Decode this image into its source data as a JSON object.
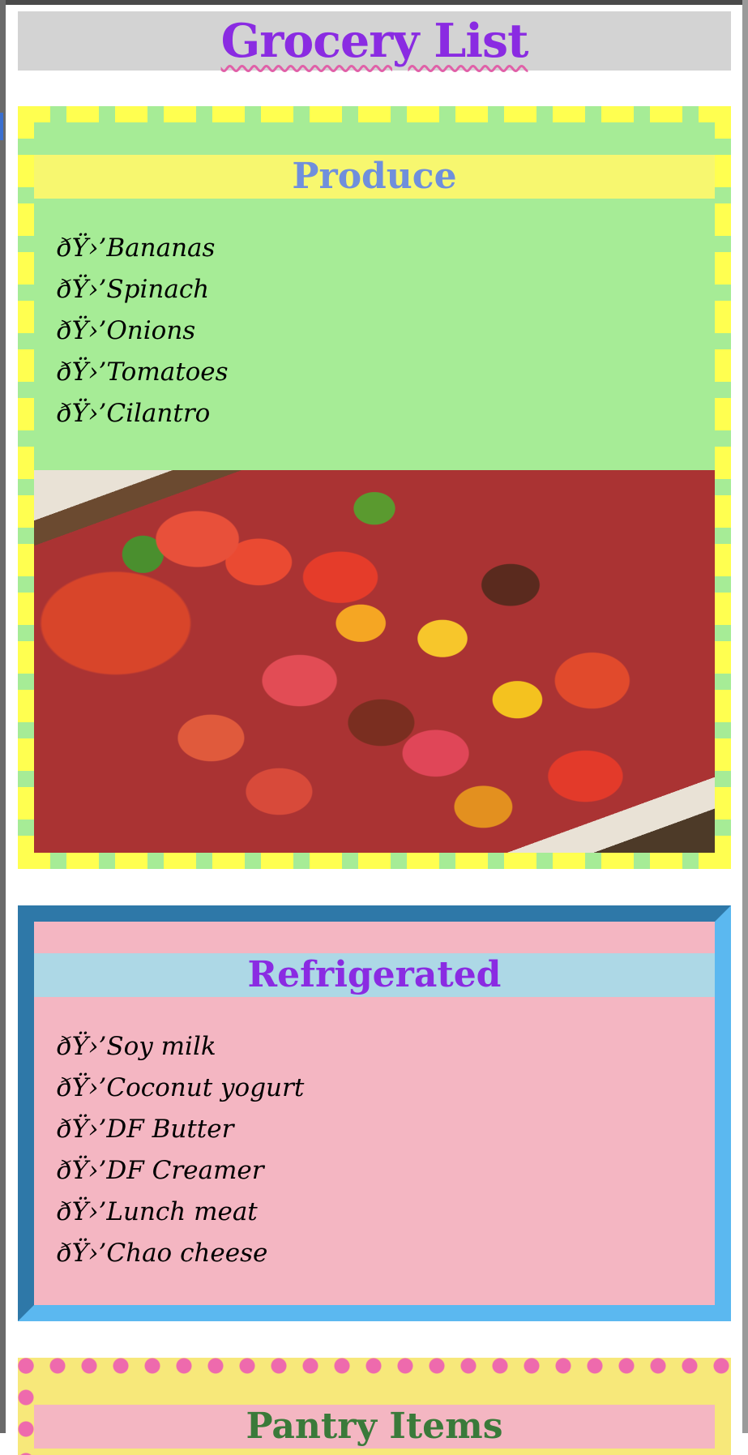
{
  "page": {
    "title": "Grocery List"
  },
  "colors": {
    "title": "#8a2be2",
    "produce_bg": "#a6ec96",
    "produce_heading_bg": "#f7f76f",
    "produce_heading_text": "#6f8fdc",
    "fridge_bg": "#f4b6c2",
    "fridge_heading_bg": "#add8e6",
    "fridge_border": "#2e78a8",
    "pantry_bg": "#f7e87a",
    "pantry_dots": "#ee6aad",
    "pantry_heading_text": "#3a7a3a"
  },
  "sections": {
    "produce": {
      "heading": "Produce",
      "items": [
        "ðŸ›’Bananas",
        "ðŸ›’Spinach",
        "ðŸ›’Onions",
        "ðŸ›’Tomatoes",
        "ðŸ›’Cilantro"
      ],
      "image_icon": "tomatoes-photo"
    },
    "refrigerated": {
      "heading": "Refrigerated",
      "items": [
        "ðŸ›’Soy milk",
        "ðŸ›’Coconut yogurt",
        "ðŸ›’DF Butter",
        "ðŸ›’DF Creamer",
        "ðŸ›’Lunch meat",
        "ðŸ›’Chao cheese"
      ]
    },
    "pantry": {
      "heading": "Pantry Items"
    }
  }
}
